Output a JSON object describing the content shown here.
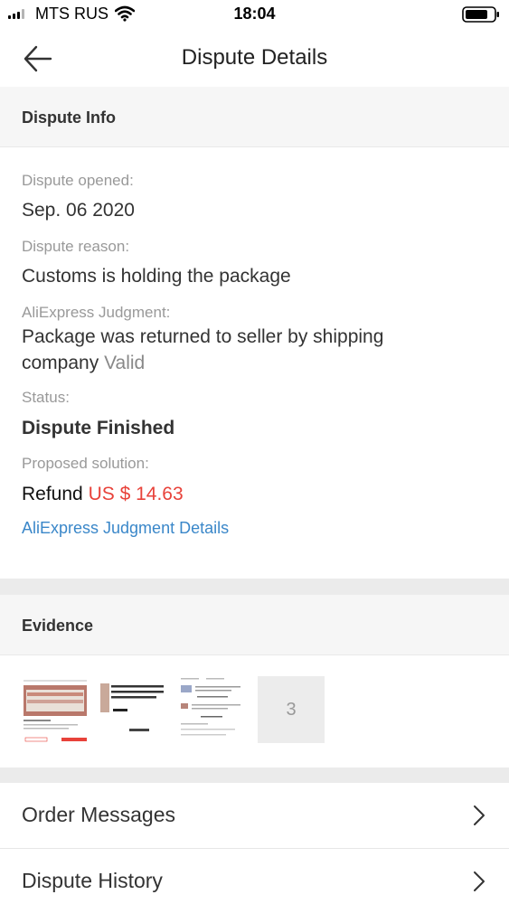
{
  "status_bar": {
    "carrier": "MTS RUS",
    "time": "18:04"
  },
  "header": {
    "title": "Dispute Details",
    "back_icon": "arrow-left-icon"
  },
  "dispute_info": {
    "section_title": "Dispute Info",
    "opened_label": "Dispute opened:",
    "opened_value": "Sep. 06 2020",
    "reason_label": "Dispute reason:",
    "reason_value": "Customs is holding the package",
    "judgment_label": "AliExpress Judgment:",
    "judgment_value": "Package was returned to seller by shipping company",
    "judgment_status": "Valid",
    "status_label": "Status:",
    "status_value": "Dispute Finished",
    "solution_label": "Proposed solution:",
    "solution_prefix": "Refund",
    "solution_amount": "US $ 14.63",
    "details_link": "AliExpress Judgment Details"
  },
  "evidence": {
    "section_title": "Evidence",
    "more_count": "3"
  },
  "rows": {
    "order_messages": "Order Messages",
    "dispute_history": "Dispute History"
  },
  "colors": {
    "price": "#e8423a",
    "link": "#3a87c9"
  }
}
